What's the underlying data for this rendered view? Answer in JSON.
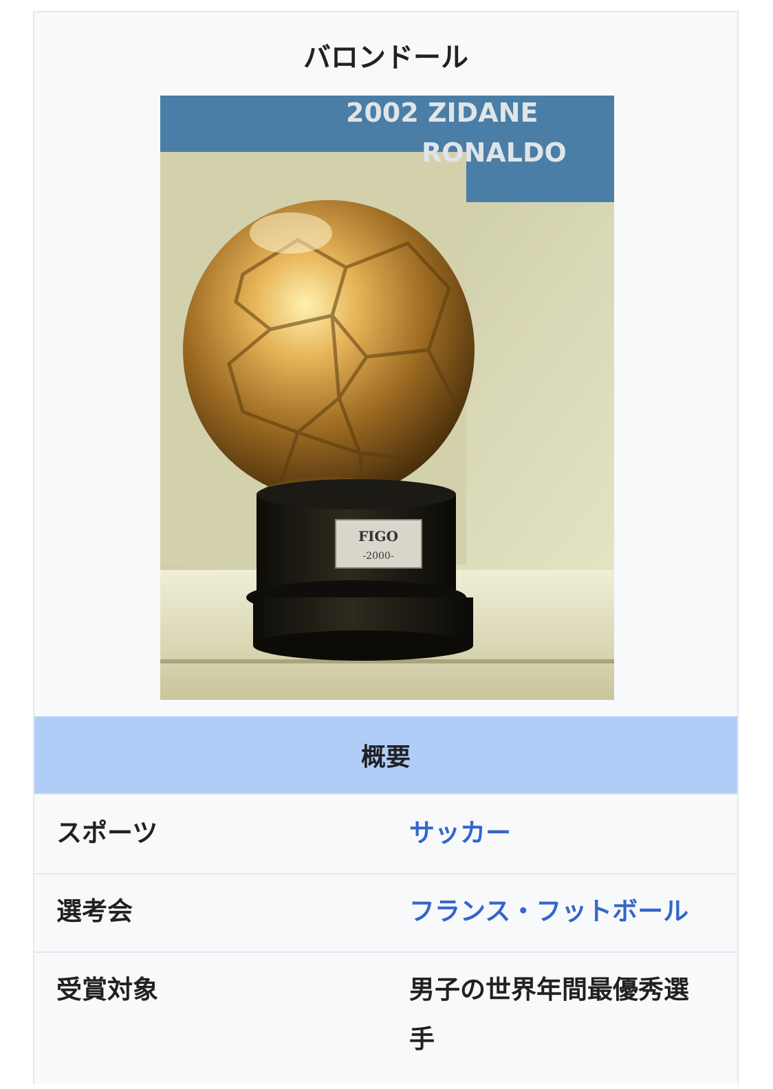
{
  "infobox": {
    "title": "バロンドール",
    "image": {
      "banner_lines": [
        "2002 ZIDANE",
        "RONALDO"
      ],
      "plaque_name": "FIGO",
      "plaque_year": "-2000-"
    },
    "section_header": "概要",
    "rows": [
      {
        "label": "スポーツ",
        "value": "サッカー",
        "is_link": true
      },
      {
        "label": "選考会",
        "value": "フランス・フットボール",
        "is_link": true
      },
      {
        "label": "受賞対象",
        "value": "男子の世界年間最優秀選手",
        "is_link": false
      }
    ]
  },
  "colors": {
    "link": "#3366cc",
    "section_header_bg": "#b0cdf8",
    "infobox_bg": "#f8f9fa",
    "text": "#202122"
  }
}
